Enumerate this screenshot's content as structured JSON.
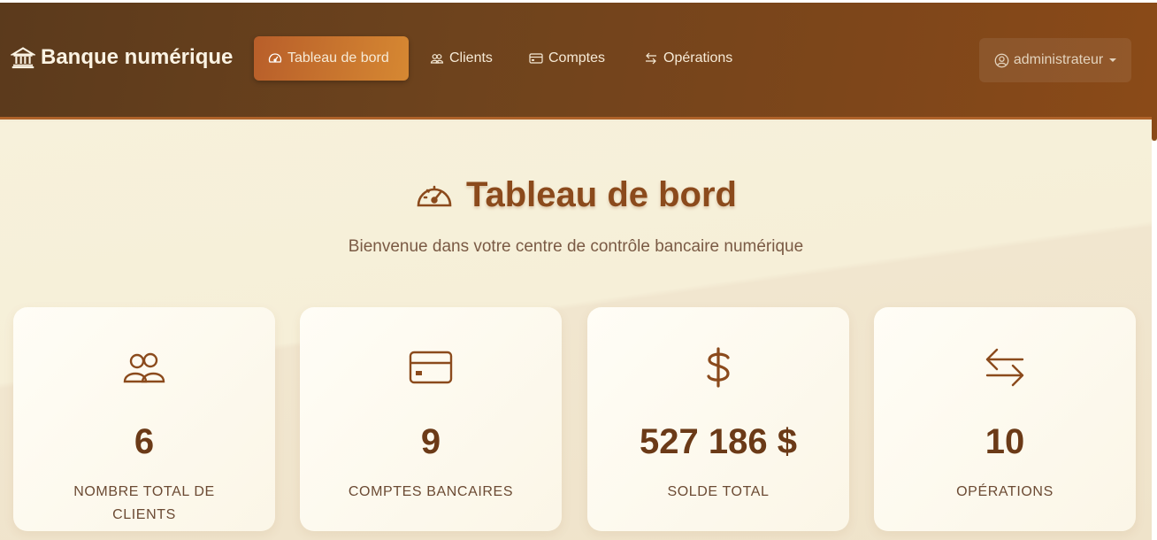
{
  "app": {
    "brand": "Banque numérique"
  },
  "nav": {
    "items": [
      {
        "label": "Tableau de bord"
      },
      {
        "label": "Clients"
      },
      {
        "label": "Comptes"
      },
      {
        "label": "Opérations"
      }
    ],
    "user": "administrateur"
  },
  "page": {
    "title": "Tableau de bord",
    "subtitle": "Bienvenue dans votre centre de contrôle bancaire numérique"
  },
  "stats": [
    {
      "icon": "people-icon",
      "value": "6",
      "label": "NOMBRE TOTAL DE CLIENTS"
    },
    {
      "icon": "credit-card-icon",
      "value": "9",
      "label": "COMPTES BANCAIRES"
    },
    {
      "icon": "dollar-icon",
      "value": "527 186 $",
      "label": "SOLDE TOTAL"
    },
    {
      "icon": "arrows-exchange-icon",
      "value": "10",
      "label": "OPÉRATIONS"
    }
  ],
  "colors": {
    "navbar": "#6e431d",
    "accent": "#d68832",
    "title": "#8b4a1c",
    "background": "#f5eed8"
  }
}
